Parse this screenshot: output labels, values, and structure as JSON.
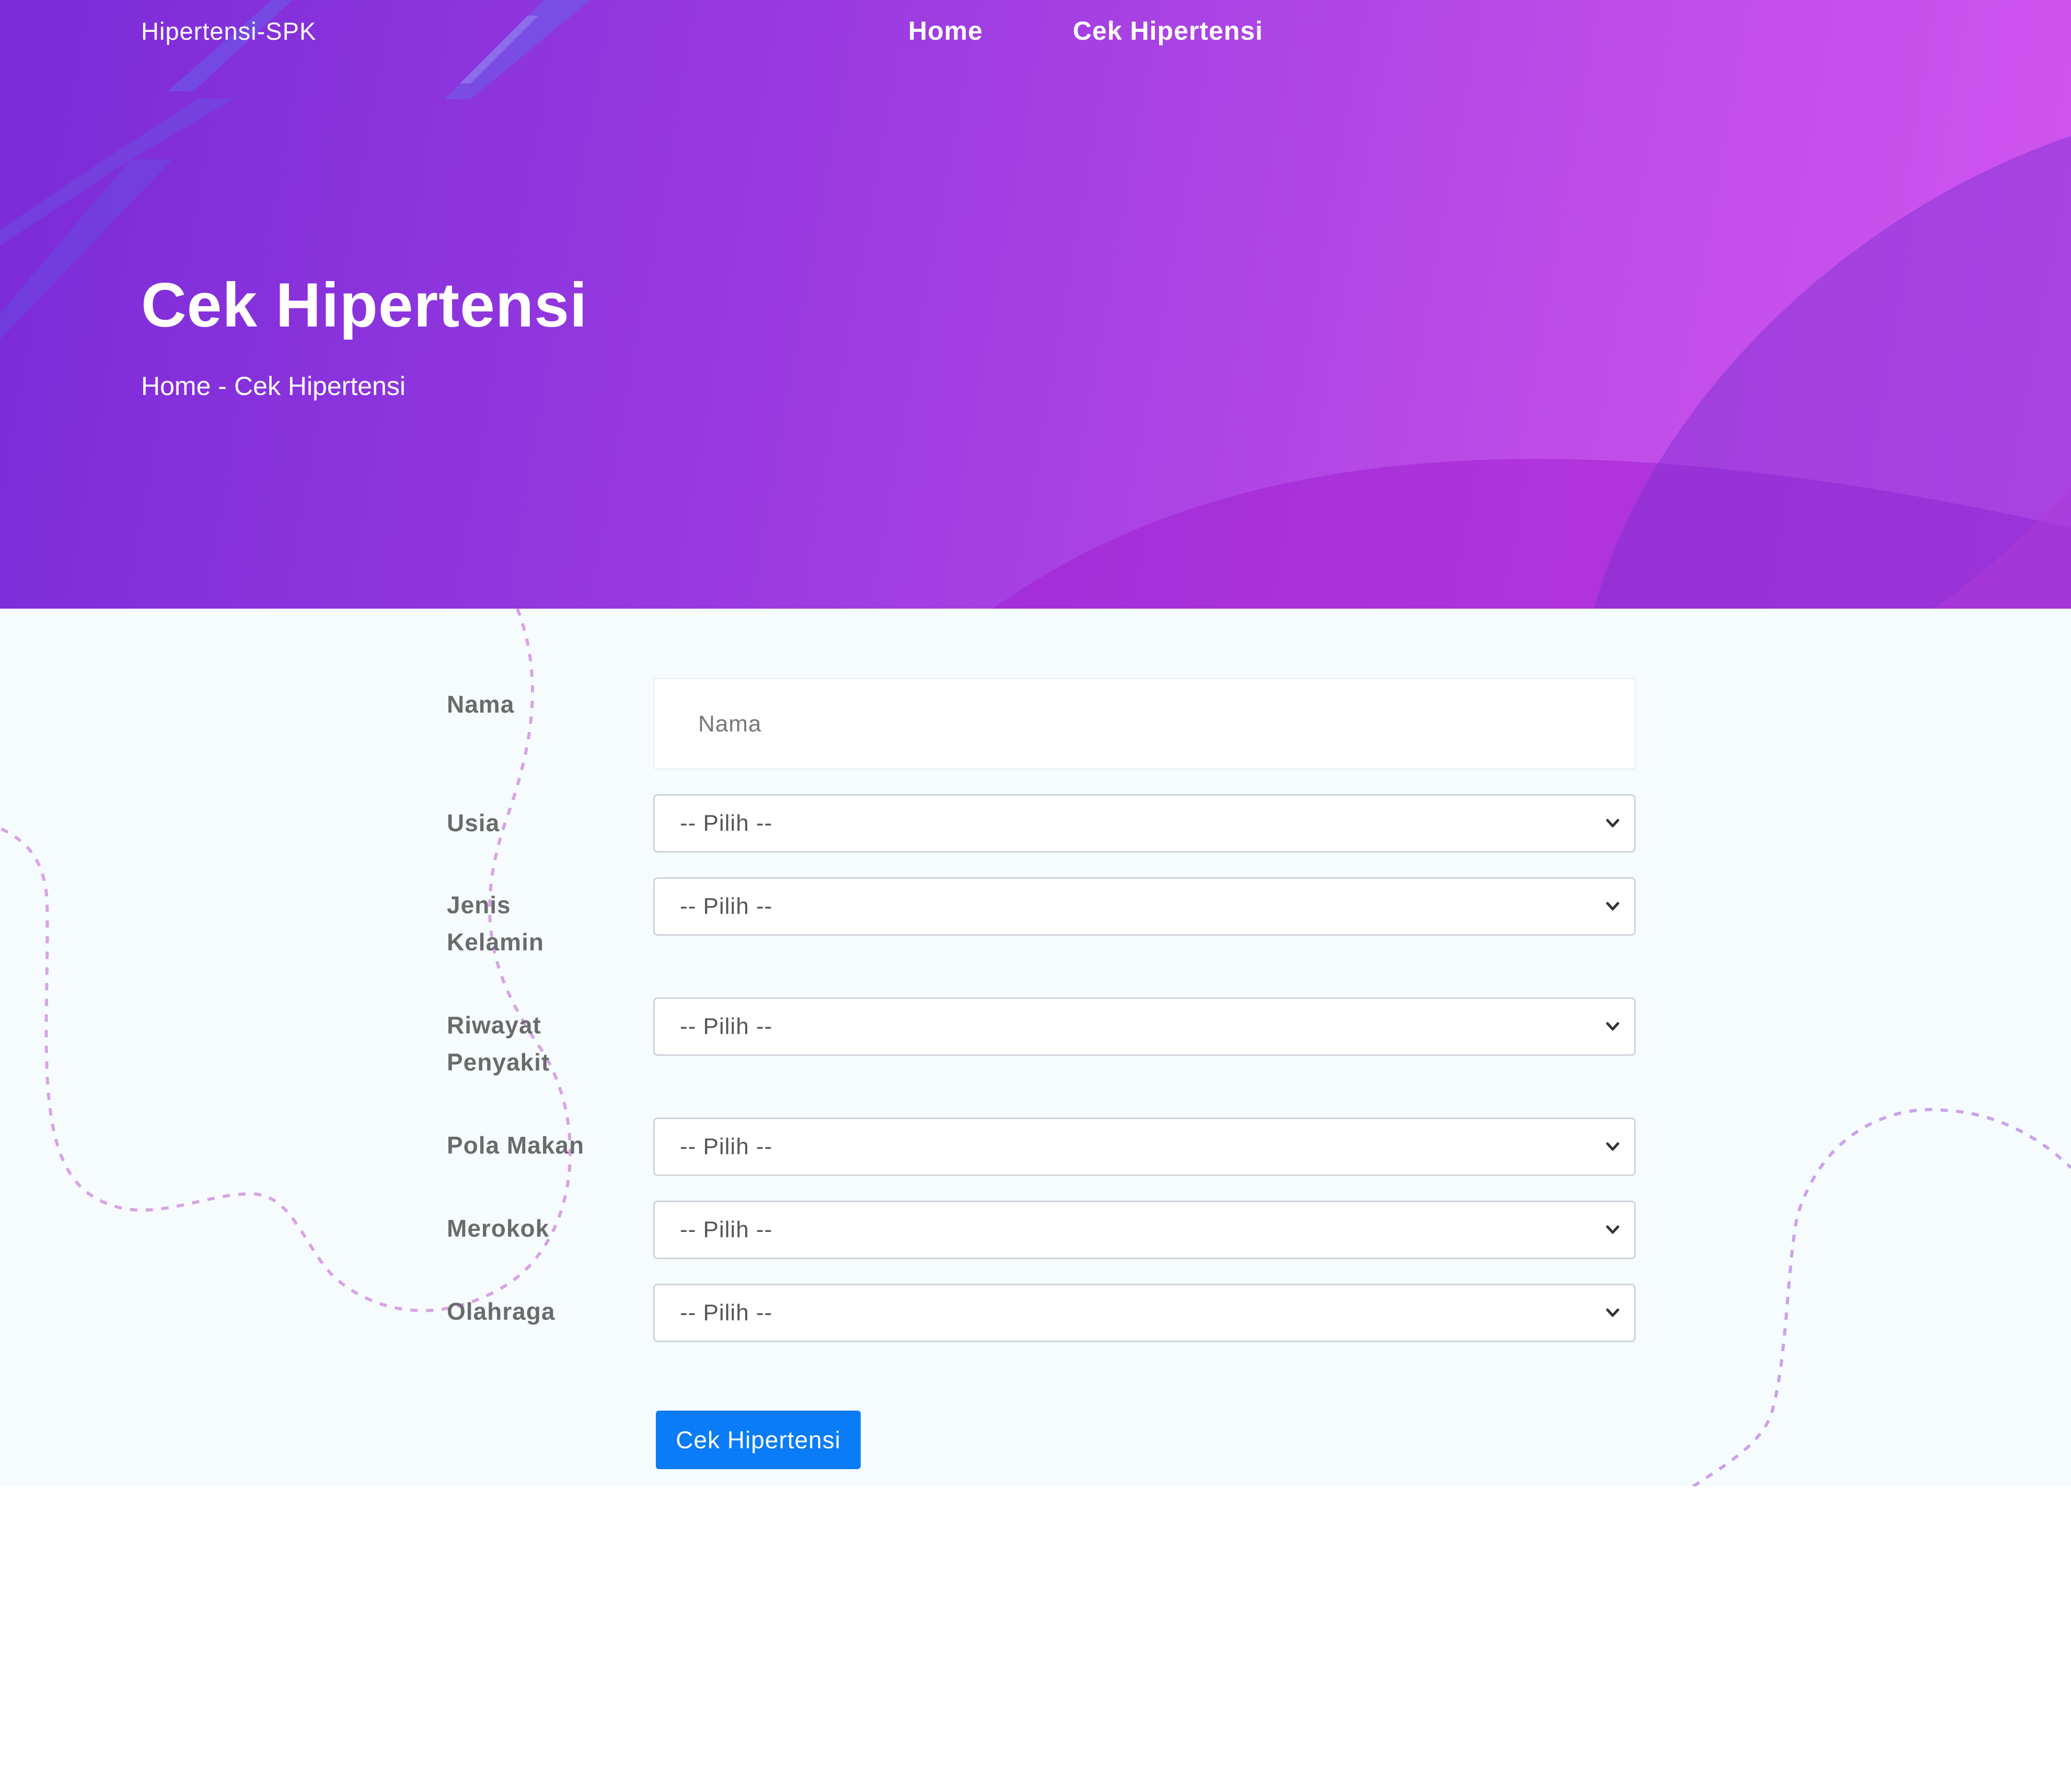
{
  "header": {
    "brand": "Hipertensi-SPK",
    "nav": [
      {
        "label": "Home"
      },
      {
        "label": "Cek Hipertensi"
      }
    ]
  },
  "hero": {
    "title": "Cek Hipertensi",
    "breadcrumb": {
      "home": "Home",
      "separator": "-",
      "current": "Cek Hipertensi"
    }
  },
  "form": {
    "nama": {
      "label": "Nama",
      "placeholder": "Nama"
    },
    "usia": {
      "label": "Usia",
      "selected": "-- Pilih --"
    },
    "jenis_kelamin": {
      "label_line1": "Jenis",
      "label_line2": "Kelamin",
      "selected": "-- Pilih --"
    },
    "riwayat_penyakit": {
      "label_line1": "Riwayat",
      "label_line2": "Penyakit",
      "selected": "-- Pilih --"
    },
    "pola_makan": {
      "label": "Pola Makan",
      "selected": "-- Pilih --"
    },
    "merokok": {
      "label": "Merokok",
      "selected": "-- Pilih --"
    },
    "olahraga": {
      "label": "Olahraga",
      "selected": "-- Pilih --"
    },
    "submit_label": "Cek Hipertensi"
  },
  "colors": {
    "hero_gradient_start": "#7b2bd9",
    "hero_gradient_end": "#d055f0",
    "button_primary": "#0a7cf7",
    "section_background": "#f6fbfd"
  }
}
